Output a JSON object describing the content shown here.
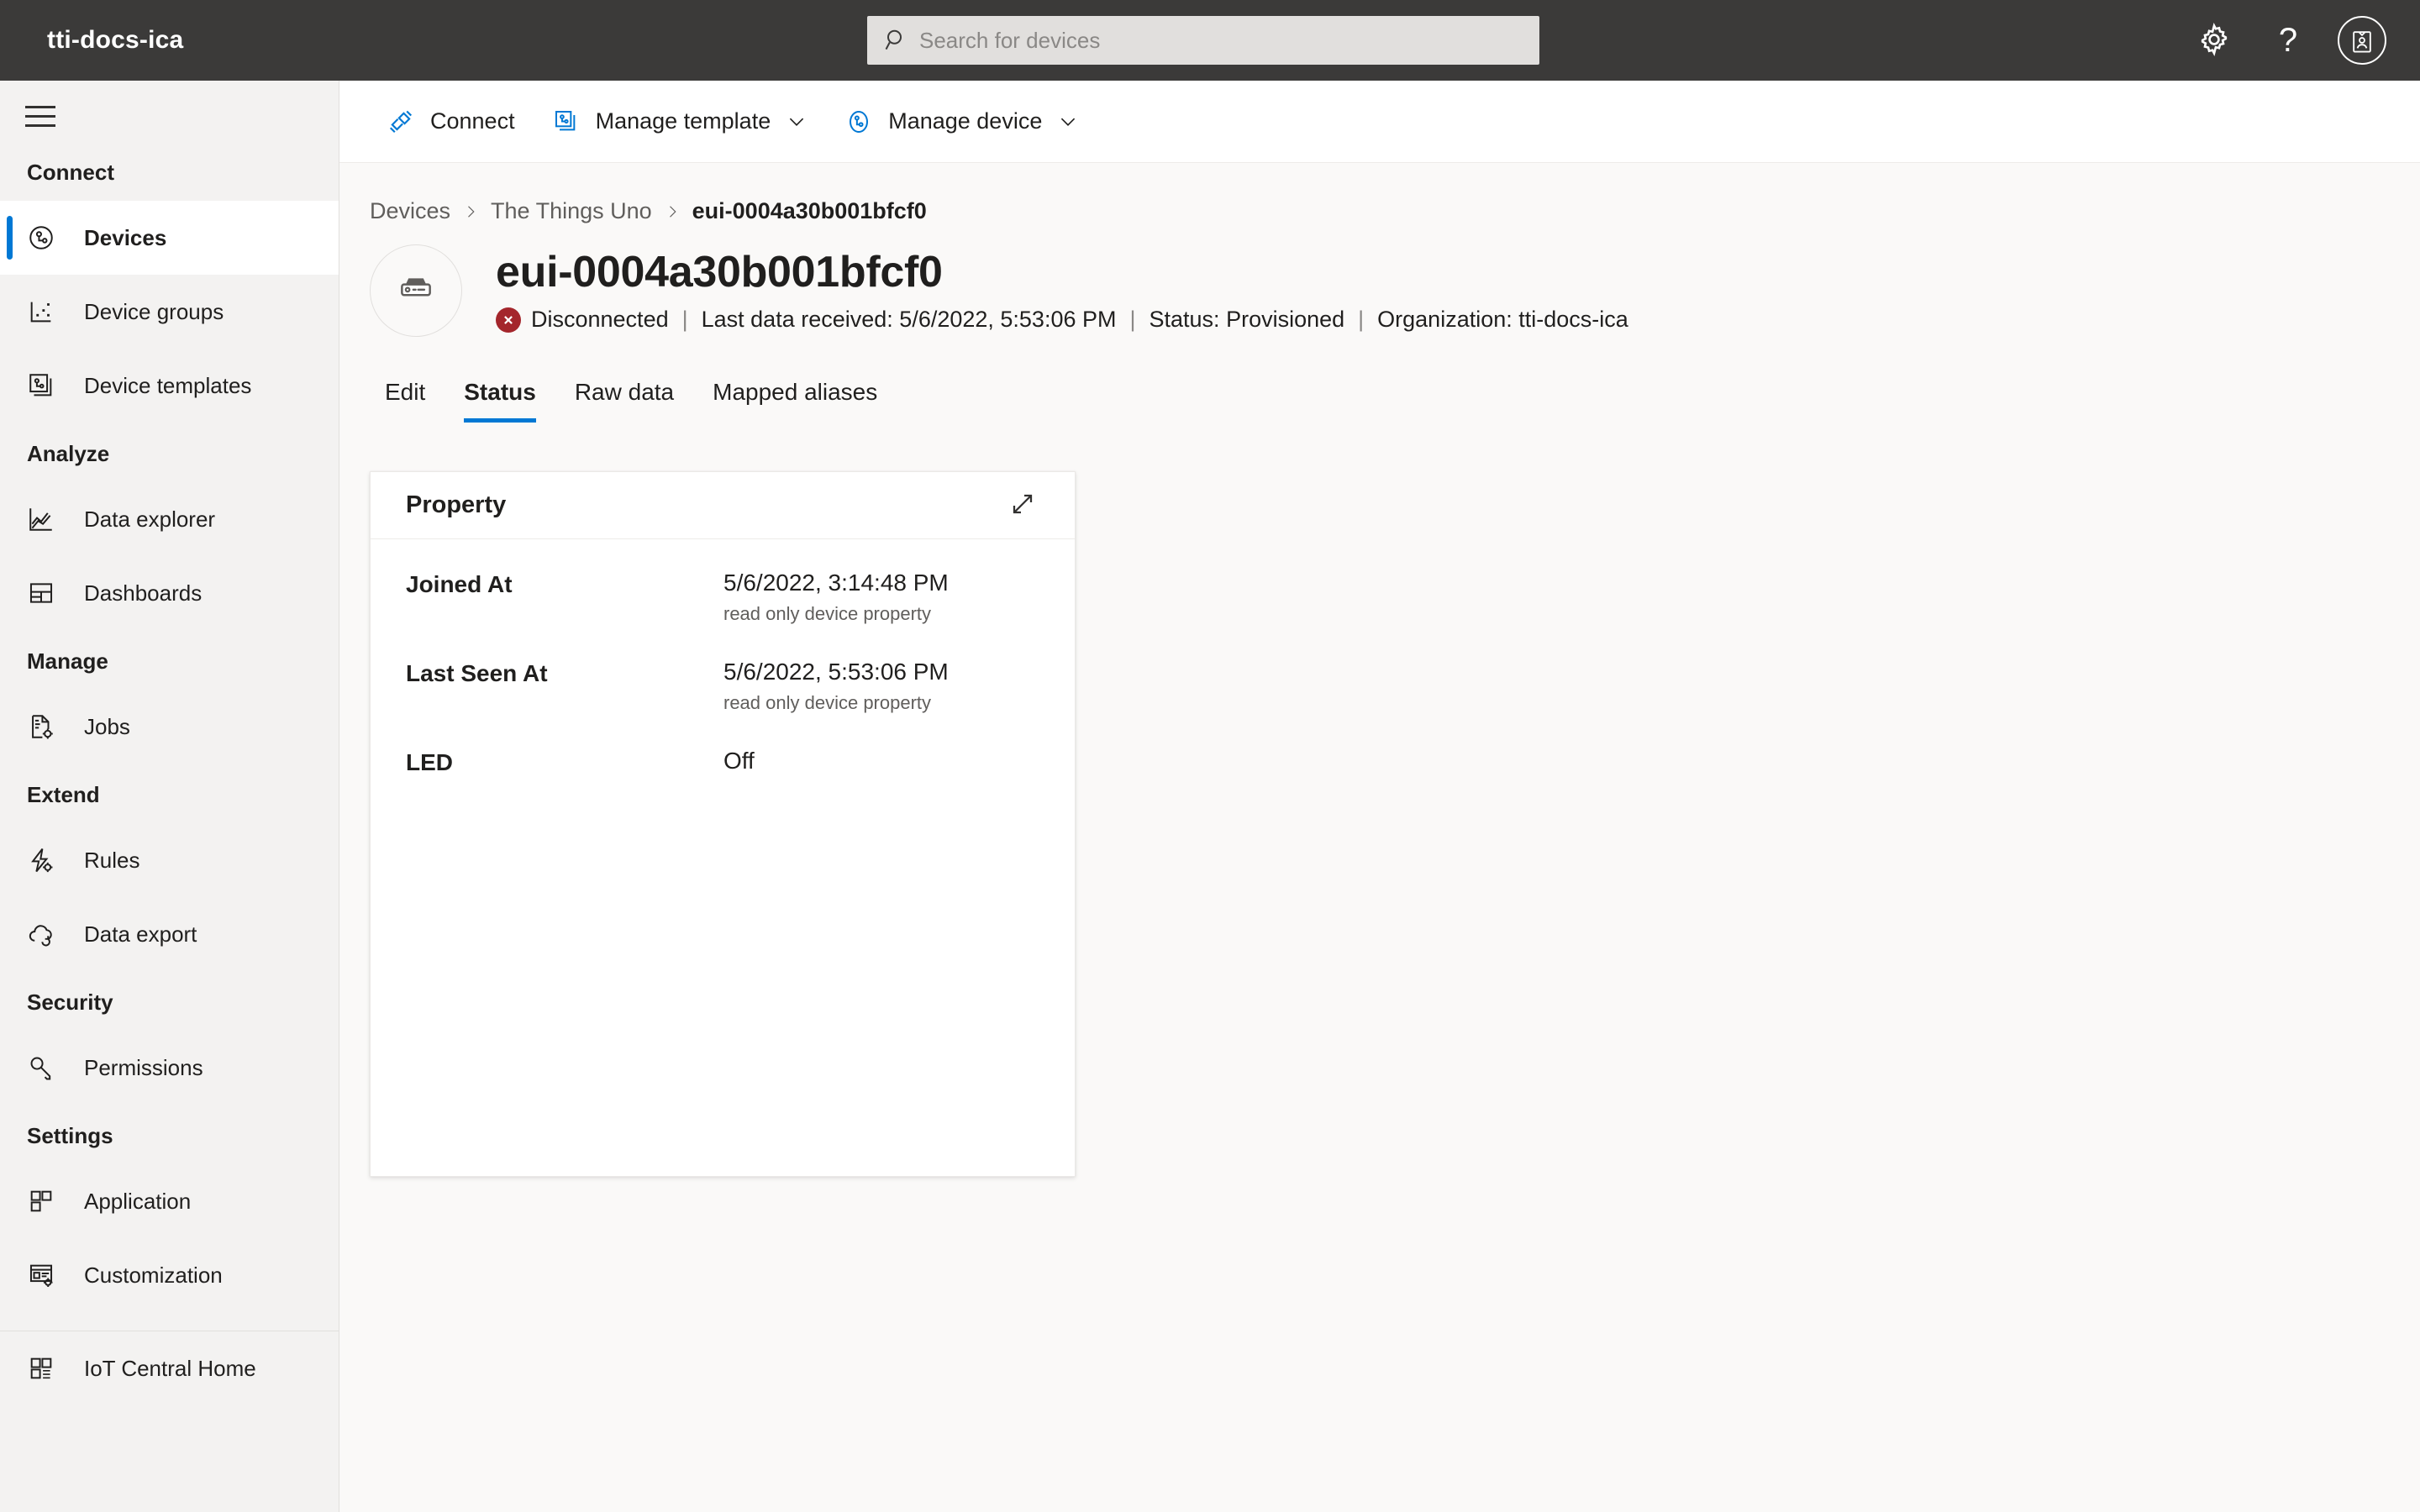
{
  "topbar": {
    "brand": "tti-docs-ica",
    "search_placeholder": "Search for devices",
    "search_value": "",
    "settings_label": "Settings",
    "help_label": "Help",
    "account_label": "Account"
  },
  "sidebar": {
    "menu_label": "Menu",
    "groups": [
      {
        "title": "Connect",
        "items": [
          {
            "label": "Devices",
            "icon": "devices-icon",
            "selected": true
          },
          {
            "label": "Device groups",
            "icon": "device-groups-icon",
            "selected": false
          },
          {
            "label": "Device templates",
            "icon": "device-templates-icon",
            "selected": false
          }
        ]
      },
      {
        "title": "Analyze",
        "items": [
          {
            "label": "Data explorer",
            "icon": "data-explorer-icon",
            "selected": false
          },
          {
            "label": "Dashboards",
            "icon": "dashboards-icon",
            "selected": false
          }
        ]
      },
      {
        "title": "Manage",
        "items": [
          {
            "label": "Jobs",
            "icon": "jobs-icon",
            "selected": false
          }
        ]
      },
      {
        "title": "Extend",
        "items": [
          {
            "label": "Rules",
            "icon": "rules-icon",
            "selected": false
          },
          {
            "label": "Data export",
            "icon": "data-export-icon",
            "selected": false
          }
        ]
      },
      {
        "title": "Security",
        "items": [
          {
            "label": "Permissions",
            "icon": "permissions-key-icon",
            "selected": false
          }
        ]
      },
      {
        "title": "Settings",
        "items": [
          {
            "label": "Application",
            "icon": "application-icon",
            "selected": false
          },
          {
            "label": "Customization",
            "icon": "customization-icon",
            "selected": false
          }
        ]
      }
    ],
    "footer": {
      "label": "IoT Central Home",
      "icon": "iot-central-home-icon"
    }
  },
  "commandbar": {
    "connect": {
      "label": "Connect",
      "icon": "connect-icon",
      "has_chevron": false
    },
    "manage_template": {
      "label": "Manage template",
      "icon": "manage-template-icon",
      "has_chevron": true
    },
    "manage_device": {
      "label": "Manage device",
      "icon": "manage-device-icon",
      "has_chevron": true
    }
  },
  "breadcrumb": {
    "items": [
      "Devices",
      "The Things Uno"
    ],
    "current": "eui-0004a30b001bfcf0",
    "separator": "›"
  },
  "device": {
    "name": "eui-0004a30b001bfcf0",
    "icon": "device-gateway-icon",
    "connection_status": "Disconnected",
    "connection_icon": "error-x-icon",
    "last_data_received_label": "Last data received:",
    "last_data_received_value": "5/6/2022, 5:53:06 PM",
    "status_label": "Status:",
    "status_value": "Provisioned",
    "organization_label": "Organization:",
    "organization_value": "tti-docs-ica",
    "separator": "|"
  },
  "tabs": [
    {
      "label": "Edit",
      "active": false
    },
    {
      "label": "Status",
      "active": true
    },
    {
      "label": "Raw data",
      "active": false
    },
    {
      "label": "Mapped aliases",
      "active": false
    }
  ],
  "property_card": {
    "title": "Property",
    "expand_icon": "expand-diagonal-icon",
    "rows": [
      {
        "name": "Joined At",
        "value": "5/6/2022, 3:14:48 PM",
        "sub": "read only device property"
      },
      {
        "name": "Last Seen At",
        "value": "5/6/2022, 5:53:06 PM",
        "sub": "read only device property"
      },
      {
        "name": "LED",
        "value": "Off",
        "sub": ""
      }
    ]
  },
  "colors": {
    "topbar_bg": "#3b3a39",
    "accent": "#0078d4",
    "page_bg": "#faf9f8",
    "sidebar_bg": "#f3f2f1",
    "error_red": "#a4262c",
    "card_bg": "#ffffff"
  }
}
